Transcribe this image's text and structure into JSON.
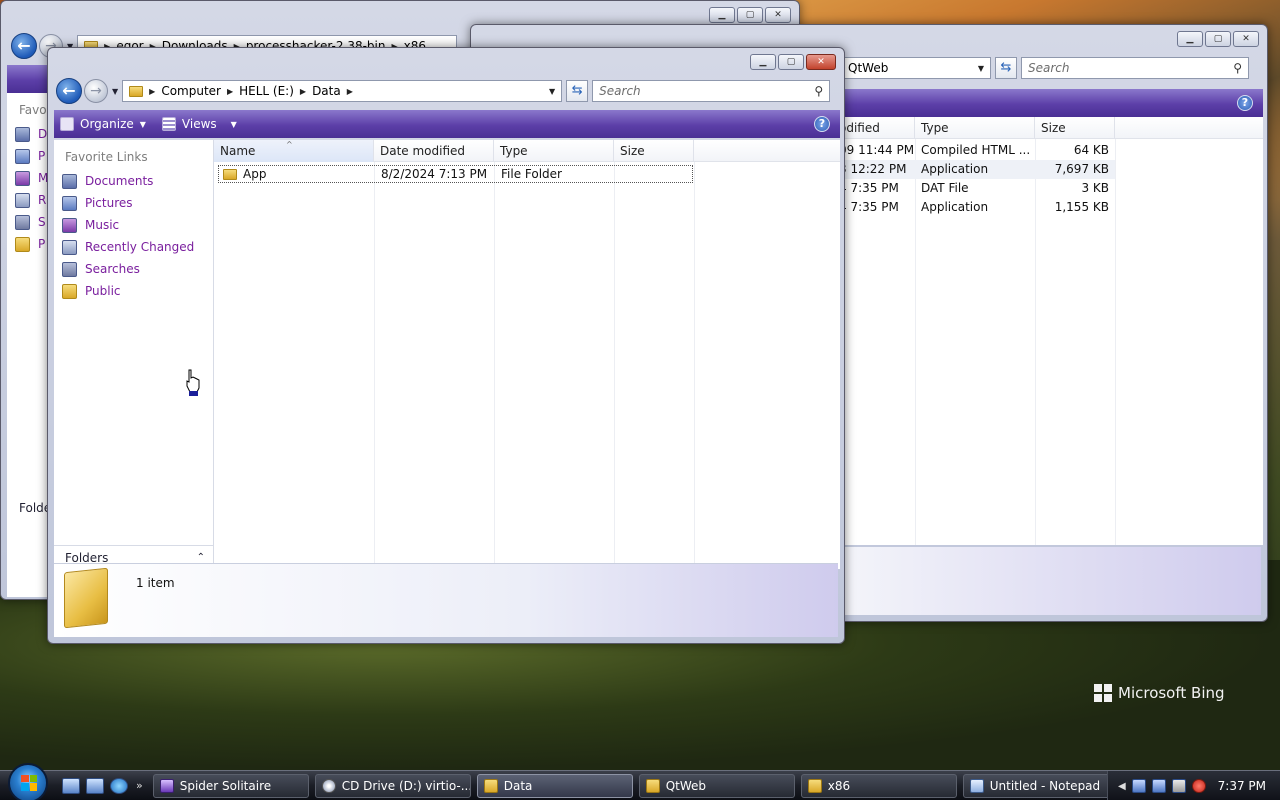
{
  "desktop": {
    "branding": "Microsoft Bing"
  },
  "win_x86": {
    "address_crumbs": [
      "egor",
      "Downloads",
      "processhacker-2.38-bin",
      "x86"
    ],
    "nav_partial": [
      "D",
      "P",
      "M",
      "R",
      "S",
      "P"
    ],
    "nav_title_partial": "Favo",
    "folders_partial": "Folde"
  },
  "win_qtweb": {
    "address_crumb": "QtWeb",
    "search_placeholder": "Search",
    "columns": {
      "modified": "odified",
      "type": "Type",
      "size": "Size"
    },
    "rows": [
      {
        "modified": "09 11:44 PM",
        "type": "Compiled HTML ...",
        "size": "64 KB"
      },
      {
        "modified": "3 12:22 PM",
        "type": "Application",
        "size": "7,697 KB"
      },
      {
        "modified": "4 7:35 PM",
        "type": "DAT File",
        "size": "3 KB"
      },
      {
        "modified": "4 7:35 PM",
        "type": "Application",
        "size": "1,155 KB"
      }
    ]
  },
  "win_data": {
    "address": {
      "crumbs": [
        "Computer",
        "HELL (E:)",
        "Data"
      ]
    },
    "search_placeholder": "Search",
    "toolbar": {
      "organize": "Organize",
      "views": "Views"
    },
    "nav": {
      "title": "Favorite Links",
      "items": [
        "Documents",
        "Pictures",
        "Music",
        "Recently Changed",
        "Searches",
        "Public"
      ],
      "folders_label": "Folders"
    },
    "columns": {
      "name": "Name",
      "date": "Date modified",
      "type": "Type",
      "size": "Size"
    },
    "rows": [
      {
        "name": "App",
        "date": "8/2/2024 7:13 PM",
        "type": "File Folder",
        "size": ""
      }
    ],
    "details": {
      "count": "1 item"
    }
  },
  "taskbar": {
    "buttons": [
      "Spider Solitaire",
      "CD Drive (D:) virtio-...",
      "Data",
      "QtWeb",
      "x86",
      "Untitled - Notepad"
    ],
    "clock": "7:37 PM"
  },
  "icons": {
    "back": "back-arrow-icon",
    "forward": "forward-arrow-icon",
    "refresh": "refresh-icon",
    "search": "magnifier-icon",
    "help": "help-icon",
    "folder": "folder-icon",
    "start": "windows-logo-icon"
  }
}
